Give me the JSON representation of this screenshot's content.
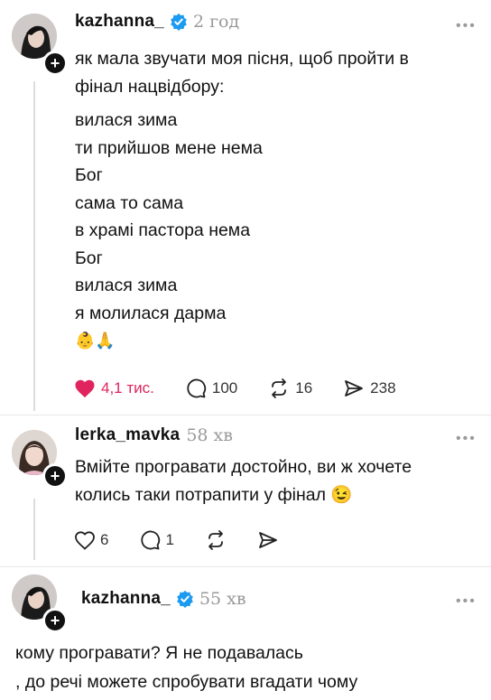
{
  "post1": {
    "username": "kazhanna_",
    "time": "2 год",
    "more": "•••",
    "caption_lines": [
      "як мала звучати моя пісня, щоб пройти в",
      "фінал нацвідбору:"
    ],
    "lyrics": [
      "вилася зима",
      "ти прийшов мене нема",
      "Бог",
      "сама то сама",
      "в храмі пастора нема",
      "Бог",
      "вилася зима",
      "я молилася дарма"
    ],
    "emojis": "👶🙏",
    "likes": "4,1 тис.",
    "comments": "100",
    "reposts": "16",
    "shares": "238"
  },
  "reply1": {
    "username": "lerka_mavka",
    "time": "58 хв",
    "more": "•••",
    "lines": [
      "Вмійте програвати достойно, ви ж хочете",
      "колись таки потрапити у фінал"
    ],
    "emoji": "😉",
    "likes": "6",
    "comments": "1"
  },
  "reply2": {
    "username": "kazhanna_",
    "time": "55 хв",
    "more": "•••",
    "lines": [
      "кому програвати? Я не подавалась",
      ", до речі можете спробувати вгадати чому"
    ]
  },
  "colors": {
    "like_red": "#e0245e",
    "verified_blue": "#1d9bf0",
    "muted": "#9a9a9a"
  }
}
